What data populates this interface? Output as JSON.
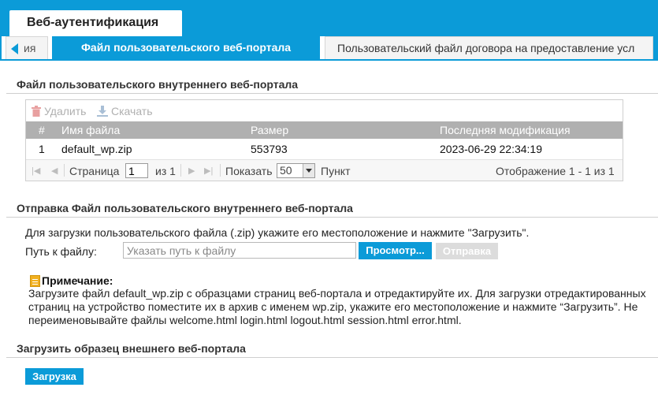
{
  "header": {
    "main_tab": "Веб-аутентификация"
  },
  "subtabs": {
    "prev_label": "ия",
    "active_label": "Файл пользовательского веб-портала",
    "next_label": "Пользовательский файл договора на предоставление усл"
  },
  "internal_portal": {
    "title": "Файл пользовательского внутреннего веб-портала",
    "toolbar": {
      "delete_label": "Удалить",
      "download_label": "Скачать"
    },
    "columns": [
      "#",
      "Имя файла",
      "Размер",
      "Последняя модификация"
    ],
    "rows": [
      [
        "1",
        "default_wp.zip",
        "553793",
        "2023-06-29 22:34:19"
      ]
    ],
    "pager": {
      "page_label": "Страница",
      "page_value": "1",
      "of_label": "из 1",
      "show_label": "Показать",
      "page_size": "50",
      "items_label": "Пункт",
      "summary": "Отображение 1 - 1 из 1"
    }
  },
  "upload": {
    "title": "Отправка Файл пользовательского внутреннего веб-портала",
    "hint": "Для загрузки пользовательского файла (.zip) укажите его местоположение и нажмите \"Загрузить\".",
    "path_label": "Путь к файлу:",
    "path_placeholder": "Указать путь к файлу",
    "browse_label": "Просмотр...",
    "send_label": "Отправка"
  },
  "note": {
    "title": "Примечание:",
    "text": "Загрузите файл default_wp.zip с образцами страниц веб-портала и отредактируйте их. Для загрузки отредактированных страниц на устройство поместите их в архив с именем wp.zip, укажите его местоположение и нажмите “Загрузить”. Не переименовывайте файлы welcome.html login.html logout.html session.html error.html."
  },
  "external_portal": {
    "title": "Загрузить образец внешнего веб-портала",
    "load_label": "Загрузка"
  },
  "colors": {
    "accent": "#0b9bd8",
    "grid_header": "#b0b0b0",
    "disabled_button": "#dcdcdc"
  }
}
